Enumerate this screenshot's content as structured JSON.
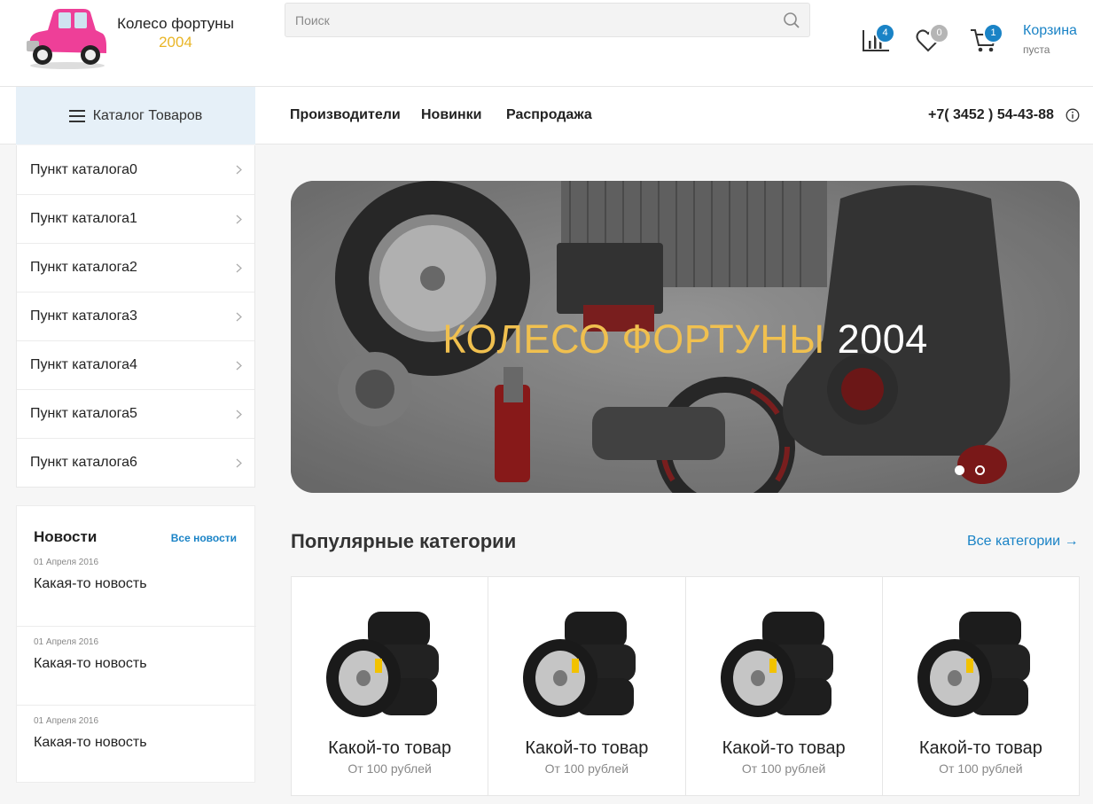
{
  "header": {
    "logo_title": "Колесо фортуны",
    "logo_year": "2004",
    "search_placeholder": "Поиск",
    "compare_count": "4",
    "favorites_count": "0",
    "cart_count": "1",
    "cart_label": "Корзина",
    "cart_status": "пуста"
  },
  "nav": {
    "catalog_label": "Каталог Товаров",
    "links": [
      "Производители",
      "Новинки",
      "Распродажа"
    ],
    "phone": "+7( 3452 ) 54-43-88"
  },
  "sidebar": {
    "items": [
      {
        "label": "Пункт каталога0"
      },
      {
        "label": "Пункт каталога1"
      },
      {
        "label": "Пункт каталога2"
      },
      {
        "label": "Пункт каталога3"
      },
      {
        "label": "Пункт каталога4"
      },
      {
        "label": "Пункт каталога5"
      },
      {
        "label": "Пункт каталога6"
      }
    ]
  },
  "news": {
    "title": "Новости",
    "all_label": "Все новости",
    "items": [
      {
        "date": "01 Апреля 2016",
        "text": "Какая-то новость"
      },
      {
        "date": "01 Апреля 2016",
        "text": "Какая-то новость"
      },
      {
        "date": "01 Апреля 2016",
        "text": "Какая-то новость"
      }
    ]
  },
  "banner": {
    "title_main": "КОЛЕСО ФОРТУНЫ",
    "title_year": "2004",
    "slides": 2,
    "active_slide": 1
  },
  "popular": {
    "title": "Популярные категории",
    "all_label": "Все категории →",
    "cards": [
      {
        "name": "Какой-то товар",
        "price": "От 100 рублей"
      },
      {
        "name": "Какой-то товар",
        "price": "От 100 рублей"
      },
      {
        "name": "Какой-то товар",
        "price": "От 100 рублей"
      },
      {
        "name": "Какой-то товар",
        "price": "От 100 рублей"
      }
    ]
  },
  "colors": {
    "accent": "#1a83c6",
    "brand_gold": "#e9b526",
    "car_pink": "#ee3f98",
    "catalog_bg": "#e6f0f8"
  }
}
